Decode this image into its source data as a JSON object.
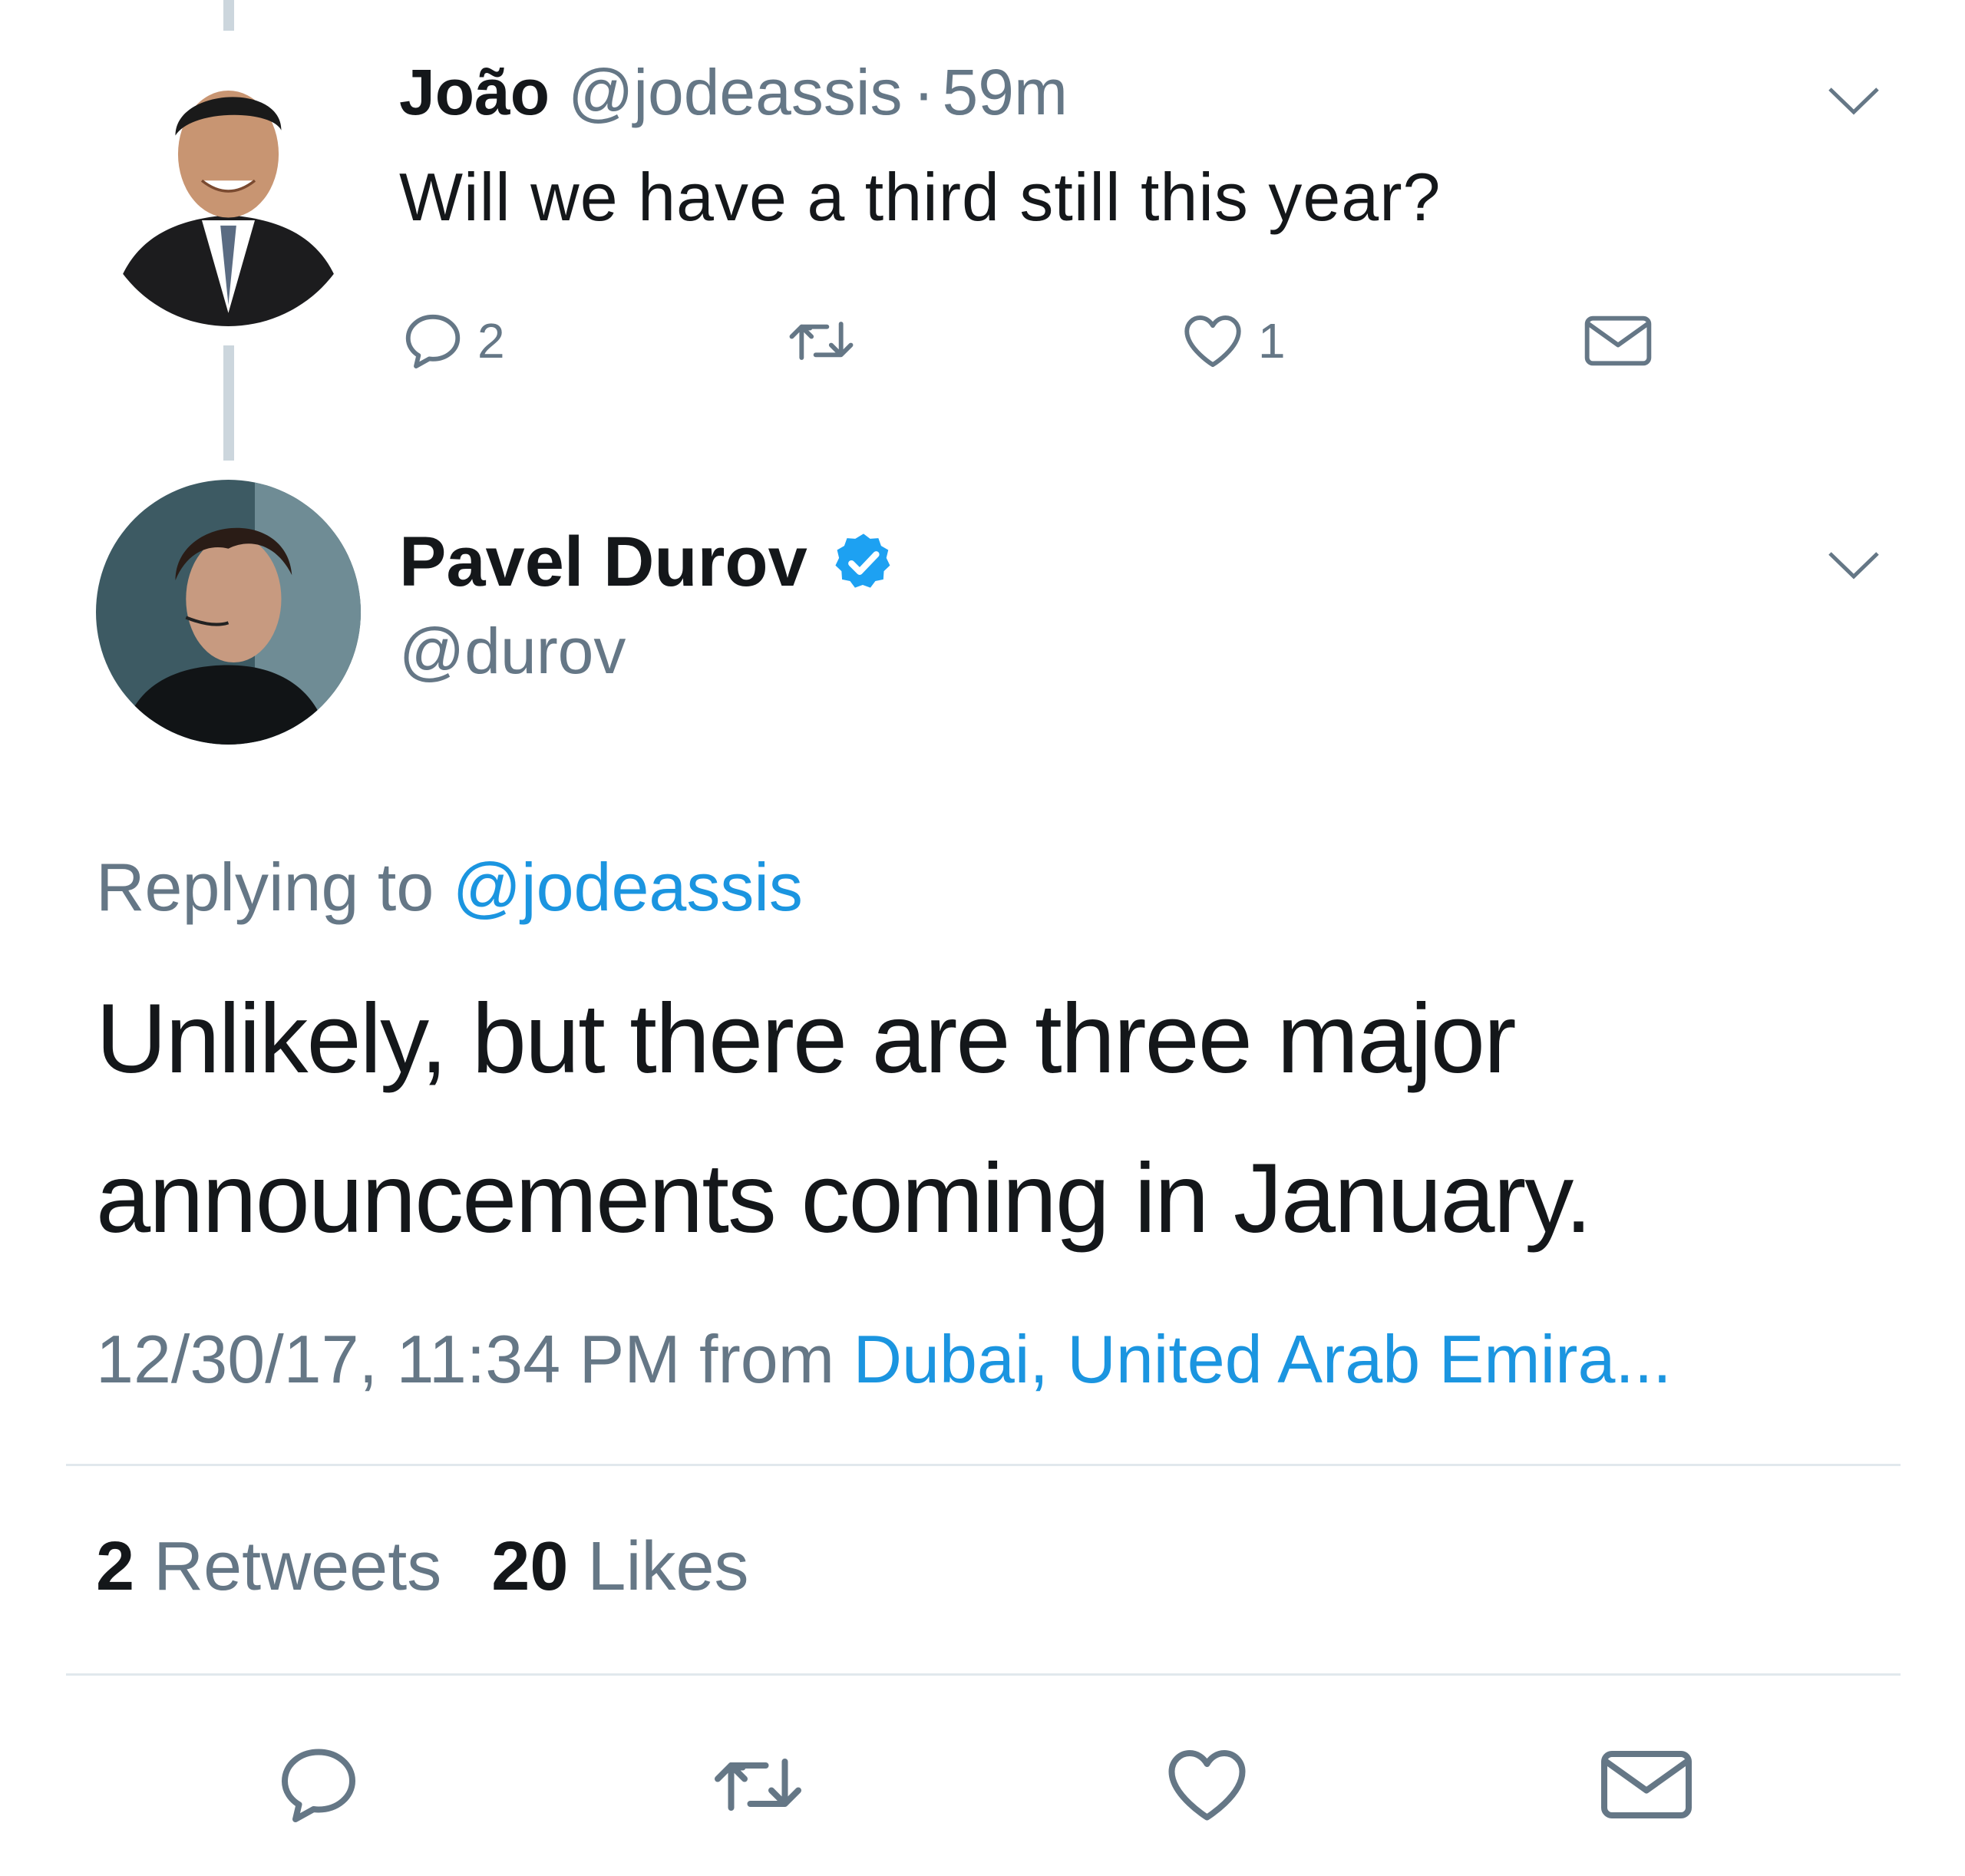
{
  "reply_tweet": {
    "name": "João",
    "handle": "@jodeassis",
    "separator": "·",
    "time": "59m",
    "text": "Will we have a third still this year?",
    "reply_count": "2",
    "like_count": "1"
  },
  "main_tweet": {
    "name": "Pavel Durov",
    "handle": "@durov",
    "replying_prefix": "Replying to",
    "replying_handle": "@jodeassis",
    "text_line1": "Unlikely, but there are three major",
    "text_line2": "announcements coming in January.",
    "timestamp": "12/30/17, 11:34 PM",
    "from_label": "from",
    "location": "Dubai, United Arab Emira...",
    "retweet_count": "2",
    "retweet_label": "Retweets",
    "like_count": "20",
    "like_label": "Likes"
  },
  "colors": {
    "link": "#1b95e0",
    "secondary_text": "#657786",
    "icon": "#657786",
    "verified": "#1da1f2",
    "divider": "#e1e8ed",
    "thread_line": "#ccd6dd"
  },
  "icons": [
    "chevron-down-icon",
    "reply-icon",
    "retweet-icon",
    "like-icon",
    "dm-icon",
    "verified-badge-icon"
  ]
}
